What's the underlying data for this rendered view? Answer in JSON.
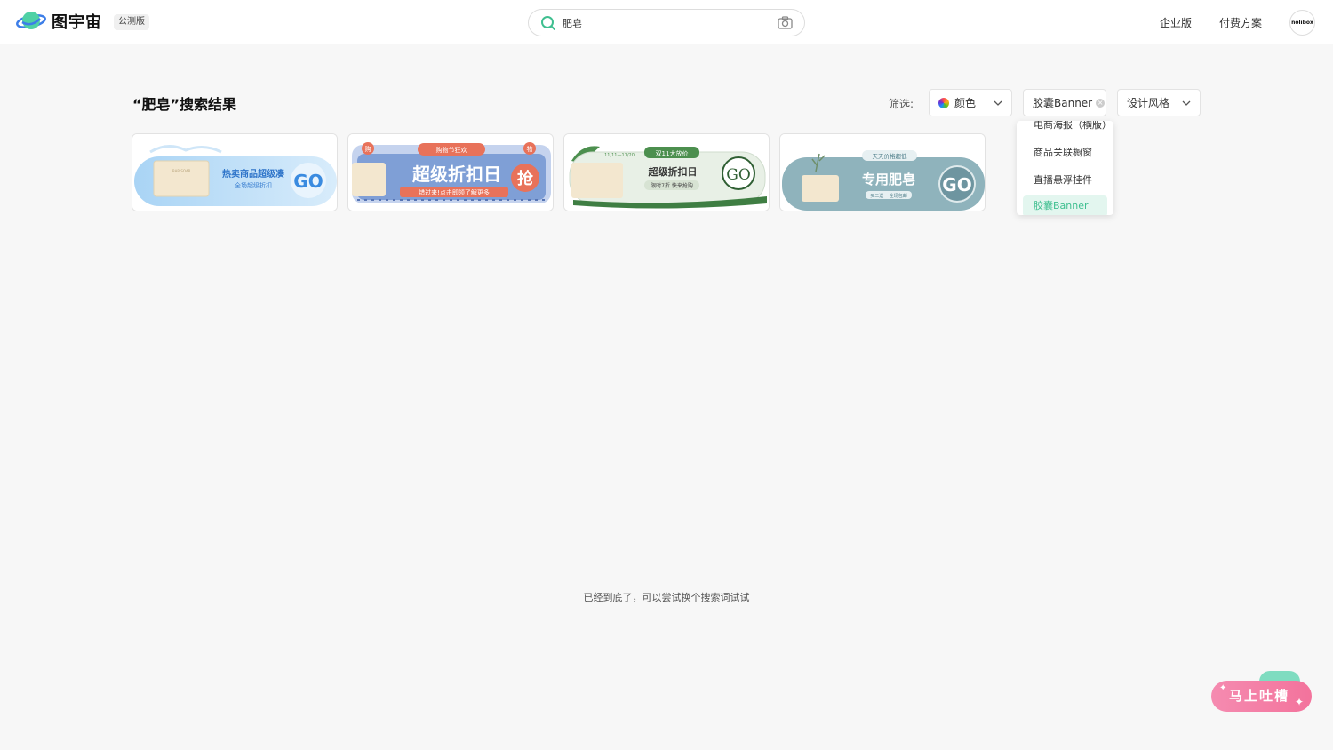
{
  "header": {
    "logo_text": "图宇宙",
    "badge": "公测版",
    "search": {
      "value": "肥皂"
    },
    "nav": [
      "企业版",
      "付费方案"
    ],
    "avatar_text": "nolibox"
  },
  "results": {
    "title": "“肥皂”搜索结果",
    "filter_label": "筛选:",
    "filters": {
      "color": "颜色",
      "type": "胶囊Banner",
      "style": "设计风格"
    },
    "dropdown": {
      "items": [
        "电商海报（横版）",
        "商品关联橱窗",
        "直播悬浮挂件",
        "胶囊Banner"
      ],
      "selected": "胶囊Banner"
    },
    "cards": [
      {
        "soap_label": "BAR SOAP",
        "headline": "热卖商品超级凑",
        "sub": "全场超级折扣",
        "cta": "GO"
      },
      {
        "tag": "购物节狂欢",
        "badge_left": "购",
        "badge_right": "物",
        "headline": "超级折扣日",
        "sub": "错过来!点击即领了解更多",
        "cta": "抢"
      },
      {
        "tag": "双11大放价",
        "date": "11/11—11/20",
        "headline": "超级折扣日",
        "sub": "限时7折 快来抢购",
        "cta": "GO"
      },
      {
        "tag": "天天价格超低",
        "headline": "专用肥皂",
        "sub": "买二送一 全场包邮",
        "cta": "GO"
      }
    ],
    "end_message": "已经到底了，可以尝试换个搜索词试试"
  },
  "feedback": {
    "label": "马上吐槽"
  },
  "colors": {
    "accent": "#3fbf90",
    "feedback_pink": "#f3739c",
    "feedback_green": "#7fdcc0"
  }
}
